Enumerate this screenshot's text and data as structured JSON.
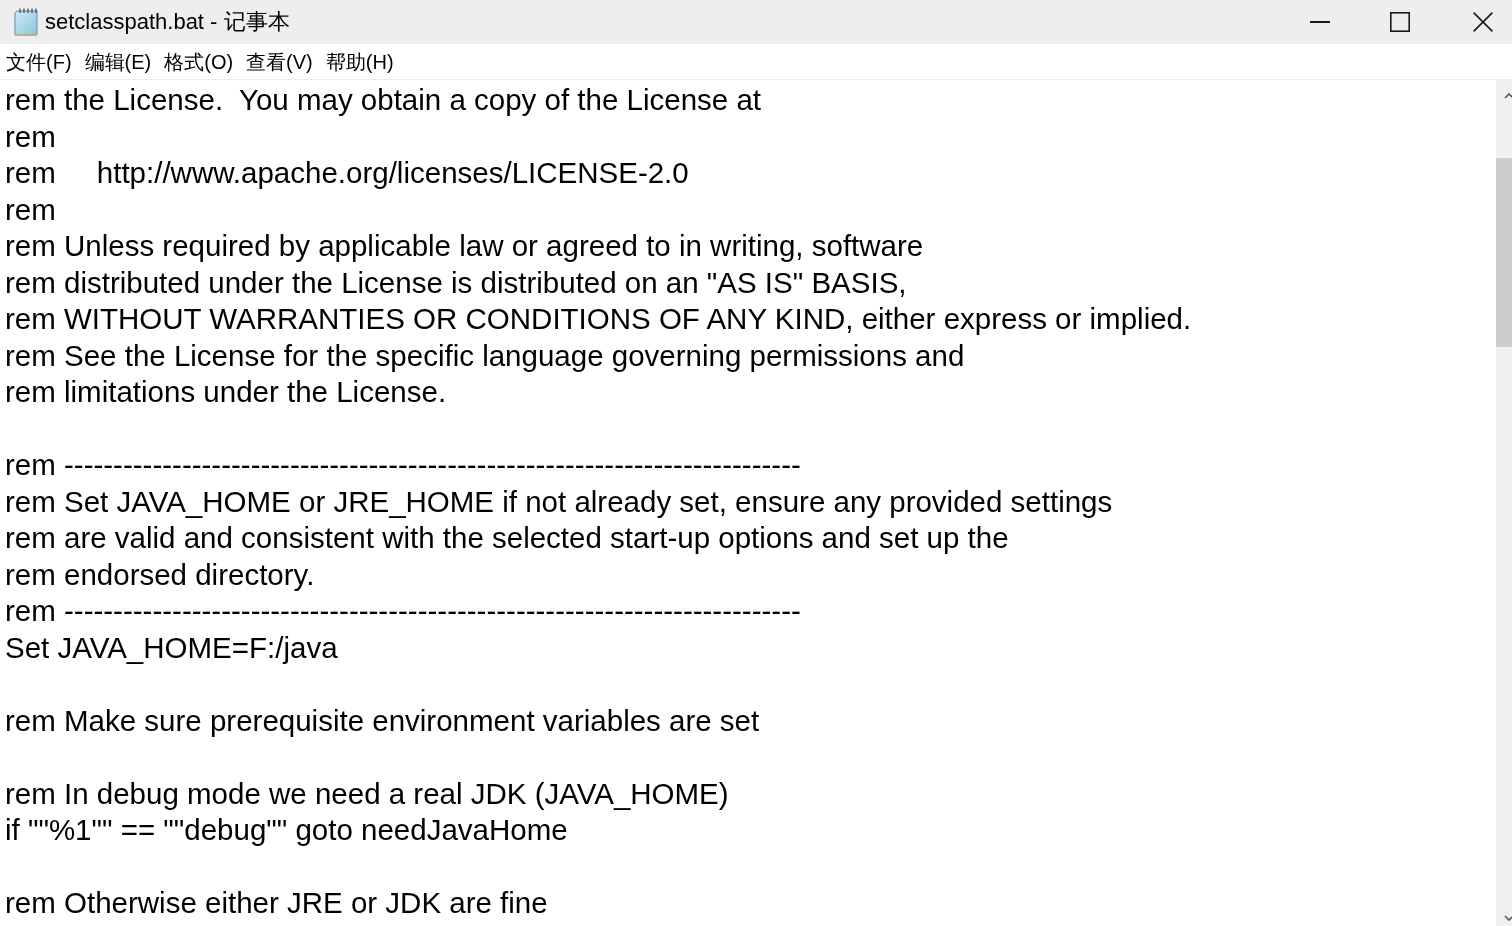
{
  "window": {
    "title": "setclasspath.bat - 记事本"
  },
  "menu_bar": [
    "文件(F)",
    "编辑(E)",
    "格式(O)",
    "查看(V)",
    "帮助(H)"
  ],
  "editor": {
    "paragraphs": [
      [
        "rem the License.  You may obtain a copy of the License at",
        "rem",
        "rem     http://www.apache.org/licenses/LICENSE-2.0",
        "rem",
        "rem Unless required by applicable law or agreed to in writing, software",
        "rem distributed under the License is distributed on an \"AS IS\" BASIS,",
        "rem WITHOUT WARRANTIES OR CONDITIONS OF ANY KIND, either express or implied.",
        "rem See the License for the specific language governing permissions and",
        "rem limitations under the License."
      ],
      [
        "rem ---------------------------------------------------------------------------",
        "rem Set JAVA_HOME or JRE_HOME if not already set, ensure any provided settings",
        "rem are valid and consistent with the selected start-up options and set up the",
        "rem endorsed directory.",
        "rem ---------------------------------------------------------------------------",
        "Set JAVA_HOME=F:/java"
      ],
      [
        "rem Make sure prerequisite environment variables are set"
      ],
      [
        "rem In debug mode we need a real JDK (JAVA_HOME)",
        "if \"\"%1\"\" == \"\"debug\"\" goto needJavaHome"
      ],
      [
        "rem Otherwise either JRE or JDK are fine"
      ]
    ]
  }
}
